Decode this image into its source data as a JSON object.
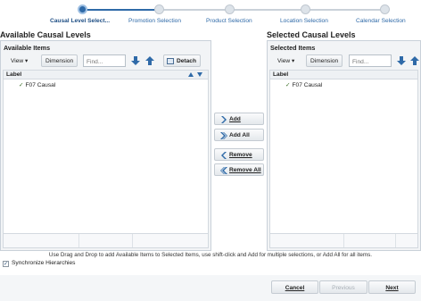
{
  "train": {
    "steps": [
      {
        "label": "Causal Level Select...",
        "state": "current"
      },
      {
        "label": "Promotion Selection",
        "state": "pending"
      },
      {
        "label": "Product Selection",
        "state": "pending"
      },
      {
        "label": "Location Selection",
        "state": "pending"
      },
      {
        "label": "Calendar Selection",
        "state": "pending"
      }
    ]
  },
  "available": {
    "title": "Available Causal Levels",
    "header": "Available Items",
    "toolbar": {
      "view": "View",
      "dimension": "Dimension",
      "find_placeholder": "Find...",
      "detach": "Detach"
    },
    "column": "Label",
    "rows": [
      "F07 Causal"
    ]
  },
  "selected": {
    "title": "Selected Causal Levels",
    "header": "Selected Items",
    "toolbar": {
      "view": "View",
      "dimension": "Dimension",
      "find_placeholder": "Find..."
    },
    "column": "Label",
    "rows": [
      "F07 Causal"
    ]
  },
  "shuttle": {
    "add": "Add",
    "add_all": "Add All",
    "remove": "Remove",
    "remove_all": "Remove All"
  },
  "hint": "Use Drag and Drop to add Available Items to Selected Items, use shift-click and Add for multiple selections, or Add All for all items.",
  "sync": {
    "label": "Synchronize Hierarchies",
    "checked": true
  },
  "nav": {
    "cancel": "Cancel",
    "previous": "Previous",
    "next": "Next"
  },
  "colors": {
    "accent": "#2f6aa8",
    "border": "#c9d1d9",
    "panel": "#f2f4f6"
  },
  "icons": {
    "view_dropdown": "caret-down-icon",
    "move_down": "arrow-down-icon",
    "move_up": "arrow-up-icon",
    "detach": "detach-icon",
    "sort_asc": "sort-asc-icon",
    "sort_desc": "sort-desc-icon",
    "check": "check-icon"
  }
}
